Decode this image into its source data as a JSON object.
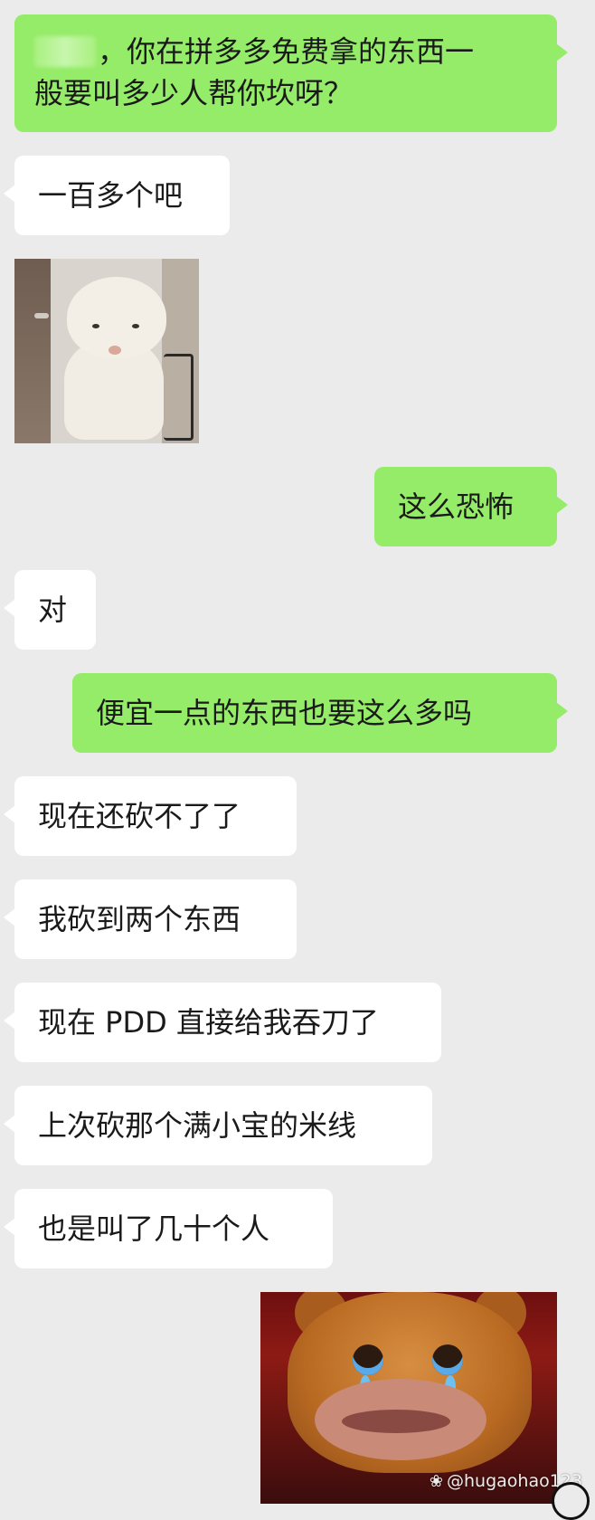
{
  "chat": {
    "messages": [
      {
        "side": "me",
        "name_prefix_blurred": true,
        "lines": [
          "，你在拼多多免费拿的东西一",
          "般要叫多少人帮你坎呀？"
        ]
      },
      {
        "side": "other",
        "lines": [
          "一百多个吧"
        ]
      },
      {
        "side": "other",
        "sticker": "alpaca-peeking-sticker"
      },
      {
        "side": "me",
        "lines": [
          "这么恐怖"
        ]
      },
      {
        "side": "other",
        "lines": [
          "对"
        ]
      },
      {
        "side": "me",
        "lines": [
          "便宜一点的东西也要这么多吗"
        ]
      },
      {
        "side": "other",
        "lines": [
          "现在还砍不了了"
        ]
      },
      {
        "side": "other",
        "lines": [
          "我砍到两个东西"
        ]
      },
      {
        "side": "other",
        "lines": [
          "现在 PDD 直接给我吞刀了"
        ]
      },
      {
        "side": "other",
        "lines": [
          "上次砍那个满小宝的米线"
        ]
      },
      {
        "side": "other",
        "lines": [
          "也是叫了几十个人"
        ]
      },
      {
        "side": "me",
        "sticker": "crying-bear-sticker"
      }
    ]
  },
  "watermark": {
    "icon": "paw-icon",
    "text": "@hugaohao123"
  },
  "colors": {
    "background": "#ebebeb",
    "my_bubble": "#95ec69",
    "other_bubble": "#ffffff",
    "text": "#1a1a1a"
  }
}
